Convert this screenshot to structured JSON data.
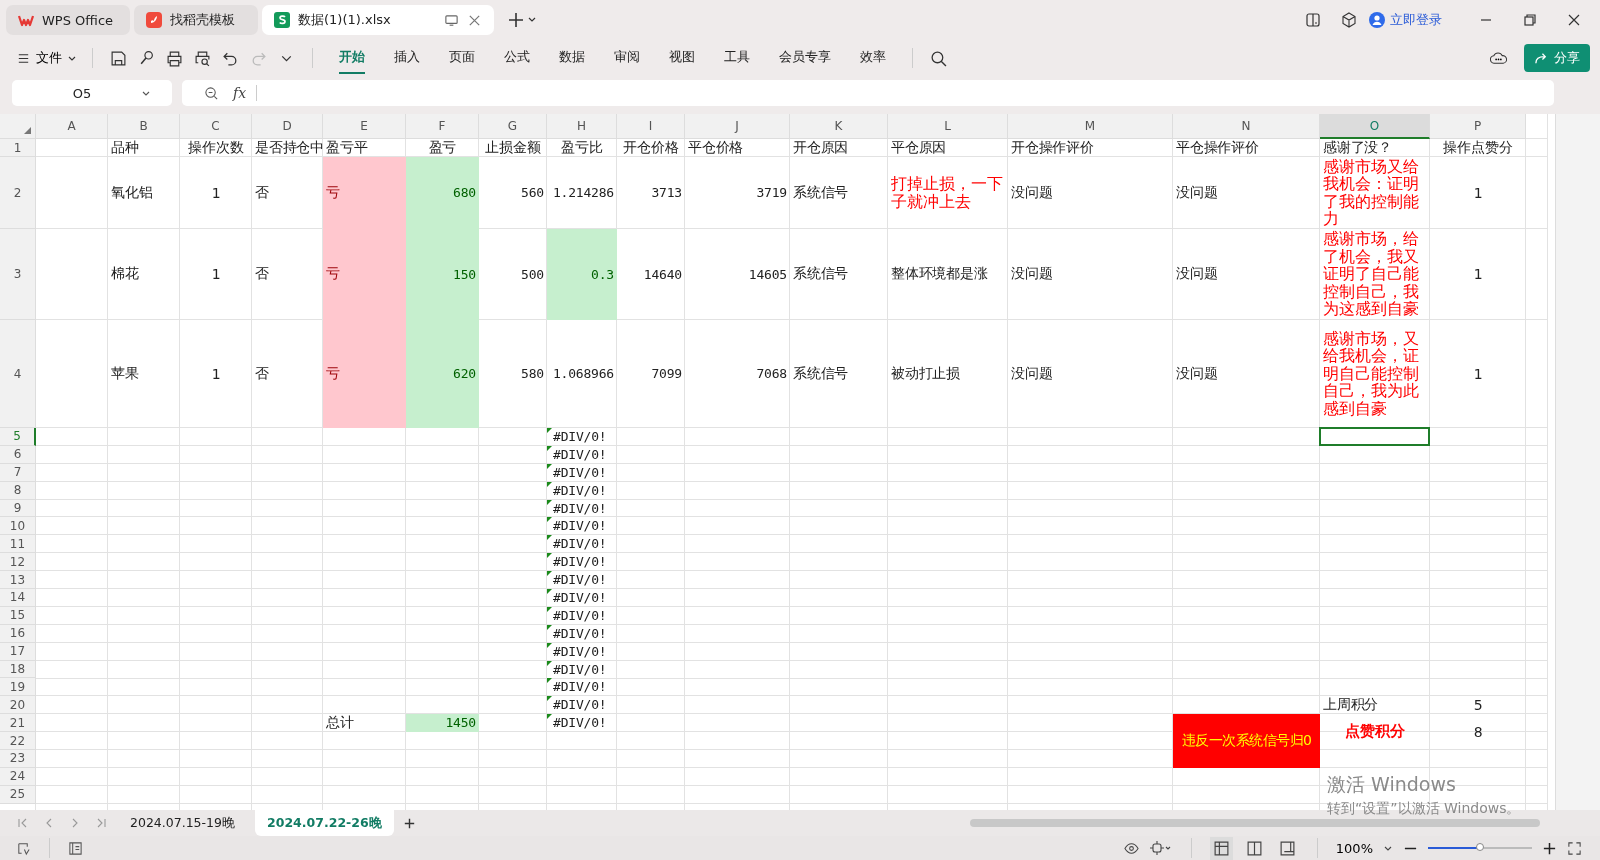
{
  "app_tabs": [
    {
      "label": "WPS Office",
      "kind": "wps",
      "selected": false
    },
    {
      "label": "找稻壳模板",
      "kind": "docer",
      "selected": false
    },
    {
      "label": "数据(1)(1).xlsx",
      "kind": "sheet",
      "selected": true
    }
  ],
  "account": {
    "login": "立即登录"
  },
  "menu": {
    "file": "文件",
    "tabs": [
      {
        "label": "开始",
        "selected": true
      },
      {
        "label": "插入",
        "selected": false
      },
      {
        "label": "页面",
        "selected": false
      },
      {
        "label": "公式",
        "selected": false
      },
      {
        "label": "数据",
        "selected": false
      },
      {
        "label": "审阅",
        "selected": false
      },
      {
        "label": "视图",
        "selected": false
      },
      {
        "label": "工具",
        "selected": false
      },
      {
        "label": "会员专享",
        "selected": false
      },
      {
        "label": "效率",
        "selected": false
      }
    ],
    "share": "分享"
  },
  "formula_bar": {
    "name_box": "O5",
    "fx": "fx"
  },
  "sheet": {
    "columns": [
      {
        "label": "A",
        "selected": false
      },
      {
        "label": "B",
        "selected": false
      },
      {
        "label": "C",
        "selected": false
      },
      {
        "label": "D",
        "selected": false
      },
      {
        "label": "E",
        "selected": false
      },
      {
        "label": "F",
        "selected": false
      },
      {
        "label": "G",
        "selected": false
      },
      {
        "label": "H",
        "selected": false
      },
      {
        "label": "I",
        "selected": false
      },
      {
        "label": "J",
        "selected": false
      },
      {
        "label": "K",
        "selected": false
      },
      {
        "label": "L",
        "selected": false
      },
      {
        "label": "M",
        "selected": false
      },
      {
        "label": "N",
        "selected": false
      },
      {
        "label": "O",
        "selected": true
      },
      {
        "label": "P",
        "selected": false
      }
    ],
    "rows": [
      {
        "label": "1",
        "selected": false,
        "cells": {
          "B": {
            "kind": "text",
            "text": "品种"
          },
          "C": {
            "kind": "center",
            "text": "操作次数"
          },
          "D": {
            "kind": "text",
            "text": "是否持仓中"
          },
          "E": {
            "kind": "text",
            "text": "盈亏平"
          },
          "F": {
            "kind": "center",
            "text": "盈亏"
          },
          "G": {
            "kind": "center",
            "text": "止损金额"
          },
          "H": {
            "kind": "center",
            "text": "盈亏比"
          },
          "I": {
            "kind": "center",
            "text": "开仓价格"
          },
          "J": {
            "kind": "text",
            "text": "平仓价格"
          },
          "K": {
            "kind": "text",
            "text": "开仓原因"
          },
          "L": {
            "kind": "text",
            "text": "平仓原因"
          },
          "M": {
            "kind": "text",
            "text": "开仓操作评价"
          },
          "N": {
            "kind": "text",
            "text": "平仓操作评价"
          },
          "O": {
            "kind": "text",
            "text": "感谢了没？"
          },
          "P": {
            "kind": "center",
            "text": "操作点赞分"
          }
        }
      },
      {
        "label": "2",
        "selected": false,
        "cells": {
          "B": {
            "kind": "text",
            "text": "氧化铝"
          },
          "C": {
            "kind": "center",
            "text": "1"
          },
          "D": {
            "kind": "text",
            "text": "否"
          },
          "E": {
            "kind": "loss",
            "text": "亏"
          },
          "F": {
            "kind": "gain",
            "text": "680"
          },
          "G": {
            "kind": "number",
            "text": "560"
          },
          "H": {
            "kind": "number",
            "text": "1.214286"
          },
          "I": {
            "kind": "number",
            "text": "3713"
          },
          "J": {
            "kind": "number",
            "text": "3719"
          },
          "K": {
            "kind": "text",
            "text": "系统信号"
          },
          "L": {
            "kind": "note",
            "text": "打掉止损，一下子就冲上去"
          },
          "M": {
            "kind": "text",
            "text": "没问题"
          },
          "N": {
            "kind": "text",
            "text": "没问题"
          },
          "O": {
            "kind": "note",
            "text": "感谢市场又给我机会：证明了我的控制能力"
          },
          "P": {
            "kind": "center",
            "text": "1"
          }
        }
      },
      {
        "label": "3",
        "selected": false,
        "cells": {
          "B": {
            "kind": "text",
            "text": "棉花"
          },
          "C": {
            "kind": "center",
            "text": "1"
          },
          "D": {
            "kind": "text",
            "text": "否"
          },
          "E": {
            "kind": "loss",
            "text": "亏"
          },
          "F": {
            "kind": "gain",
            "text": "150"
          },
          "G": {
            "kind": "number",
            "text": "500"
          },
          "H": {
            "kind": "gain",
            "text": "0.3"
          },
          "I": {
            "kind": "number",
            "text": "14640"
          },
          "J": {
            "kind": "number",
            "text": "14605"
          },
          "K": {
            "kind": "text",
            "text": "系统信号"
          },
          "L": {
            "kind": "text",
            "text": "整体环境都是涨"
          },
          "M": {
            "kind": "text",
            "text": "没问题"
          },
          "N": {
            "kind": "text",
            "text": "没问题"
          },
          "O": {
            "kind": "note",
            "text": "感谢市场，给了机会，我又证明了自己能控制自己，我为这感到自豪"
          },
          "P": {
            "kind": "center",
            "text": "1"
          }
        }
      },
      {
        "label": "4",
        "selected": false,
        "cells": {
          "B": {
            "kind": "text",
            "text": "苹果"
          },
          "C": {
            "kind": "center",
            "text": "1"
          },
          "D": {
            "kind": "text",
            "text": "否"
          },
          "E": {
            "kind": "loss",
            "text": "亏"
          },
          "F": {
            "kind": "gain",
            "text": "620"
          },
          "G": {
            "kind": "number",
            "text": "580"
          },
          "H": {
            "kind": "number",
            "text": "1.068966"
          },
          "I": {
            "kind": "number",
            "text": "7099"
          },
          "J": {
            "kind": "number",
            "text": "7068"
          },
          "K": {
            "kind": "text",
            "text": "系统信号"
          },
          "L": {
            "kind": "text",
            "text": "被动打止损"
          },
          "M": {
            "kind": "text",
            "text": "没问题"
          },
          "N": {
            "kind": "text",
            "text": "没问题"
          },
          "O": {
            "kind": "note",
            "text": "感谢市场，又给我机会，证明自己能控制自己，我为此感到自豪"
          },
          "P": {
            "kind": "center",
            "text": "1"
          }
        }
      },
      {
        "label": "5",
        "selected": true,
        "cells": {
          "H": {
            "kind": "error",
            "text": "#DIV/0!"
          }
        }
      },
      {
        "label": "6",
        "selected": false,
        "cells": {
          "H": {
            "kind": "error",
            "text": "#DIV/0!"
          }
        }
      },
      {
        "label": "7",
        "selected": false,
        "cells": {
          "H": {
            "kind": "error",
            "text": "#DIV/0!"
          }
        }
      },
      {
        "label": "8",
        "selected": false,
        "cells": {
          "H": {
            "kind": "error",
            "text": "#DIV/0!"
          }
        }
      },
      {
        "label": "9",
        "selected": false,
        "cells": {
          "H": {
            "kind": "error",
            "text": "#DIV/0!"
          }
        }
      },
      {
        "label": "10",
        "selected": false,
        "cells": {
          "H": {
            "kind": "error",
            "text": "#DIV/0!"
          }
        }
      },
      {
        "label": "11",
        "selected": false,
        "cells": {
          "H": {
            "kind": "error",
            "text": "#DIV/0!"
          }
        }
      },
      {
        "label": "12",
        "selected": false,
        "cells": {
          "H": {
            "kind": "error",
            "text": "#DIV/0!"
          }
        }
      },
      {
        "label": "13",
        "selected": false,
        "cells": {
          "H": {
            "kind": "error",
            "text": "#DIV/0!"
          }
        }
      },
      {
        "label": "14",
        "selected": false,
        "cells": {
          "H": {
            "kind": "error",
            "text": "#DIV/0!"
          }
        }
      },
      {
        "label": "15",
        "selected": false,
        "cells": {
          "H": {
            "kind": "error",
            "text": "#DIV/0!"
          }
        }
      },
      {
        "label": "16",
        "selected": false,
        "cells": {
          "H": {
            "kind": "error",
            "text": "#DIV/0!"
          }
        }
      },
      {
        "label": "17",
        "selected": false,
        "cells": {
          "H": {
            "kind": "error",
            "text": "#DIV/0!"
          }
        }
      },
      {
        "label": "18",
        "selected": false,
        "cells": {
          "H": {
            "kind": "error",
            "text": "#DIV/0!"
          }
        }
      },
      {
        "label": "19",
        "selected": false,
        "cells": {
          "H": {
            "kind": "error",
            "text": "#DIV/0!"
          }
        }
      },
      {
        "label": "20",
        "selected": false,
        "cells": {
          "H": {
            "kind": "error",
            "text": "#DIV/0!"
          },
          "O": {
            "kind": "text",
            "text": "上周积分"
          },
          "P": {
            "kind": "center",
            "text": "5"
          }
        }
      },
      {
        "label": "21",
        "selected": false,
        "cells": {
          "E": {
            "kind": "text",
            "text": "总计"
          },
          "F": {
            "kind": "gain",
            "text": "1450"
          },
          "H": {
            "kind": "error",
            "text": "#DIV/0!"
          },
          "N": {
            "kind": "alert",
            "text": "违反一次系统信号归0"
          },
          "O": {
            "kind": "score",
            "text": "点赞积分"
          },
          "P": {
            "kind": "score_value",
            "text": "8"
          }
        }
      },
      {
        "label": "22",
        "selected": false
      },
      {
        "label": "23",
        "selected": false
      },
      {
        "label": "24",
        "selected": false
      },
      {
        "label": "25",
        "selected": false
      }
    ]
  },
  "sheet_tabs": [
    {
      "label": "2024.07.15-19晚",
      "selected": false
    },
    {
      "label": "2024.07.22-26晚",
      "selected": true
    }
  ],
  "status_bar": {
    "zoom": "100%",
    "zoom_slider": {
      "level": 0.5
    }
  },
  "os_notice": {
    "title": "激活 Windows",
    "text": "转到“设置”以激活 Windows。"
  }
}
